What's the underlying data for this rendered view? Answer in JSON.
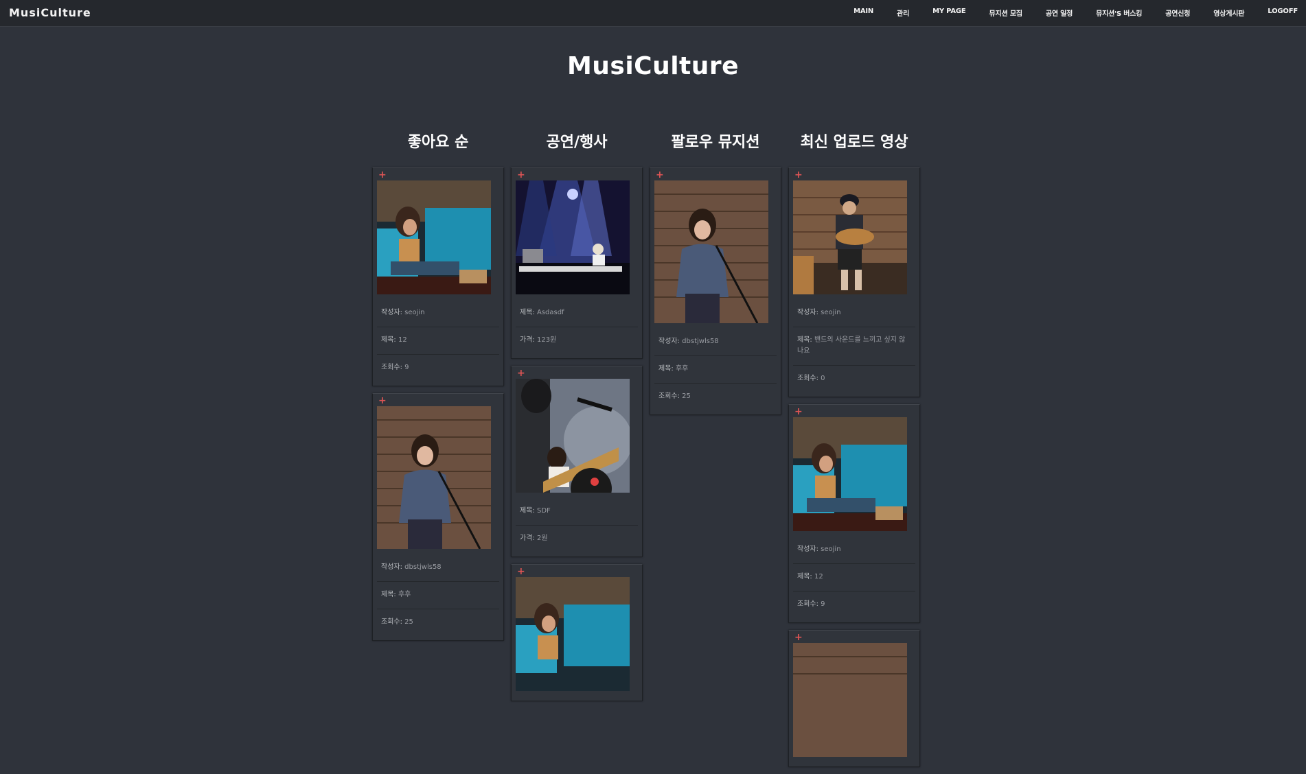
{
  "brand": "MusiCulture",
  "nav": [
    "MAIN",
    "관리",
    "MY PAGE",
    "뮤지션 모집",
    "공연 일정",
    "뮤지션'S 버스킹",
    "공연신청",
    "영상게시판",
    "LOGOFF"
  ],
  "hero_title": "MusiCulture",
  "columns": [
    {
      "heading": "좋아요 순",
      "cards": [
        {
          "image": "woman-singing-blue-stage",
          "rows": [
            {
              "key": "작성자:",
              "value": "seojin"
            },
            {
              "key": "제목:",
              "value": "12"
            },
            {
              "key": "조회수:",
              "value": "9"
            }
          ]
        },
        {
          "image": "woman-singing-wood-wall",
          "rows": [
            {
              "key": "작성자:",
              "value": "dbstjwls58"
            },
            {
              "key": "제목:",
              "value": "후후"
            },
            {
              "key": "조회수:",
              "value": "25"
            }
          ]
        }
      ]
    },
    {
      "heading": "공연/행사",
      "cards": [
        {
          "image": "concert-stage-lights",
          "rows": [
            {
              "key": "제목:",
              "value": "Asdasdf"
            },
            {
              "key": "가격:",
              "value": "123원"
            }
          ]
        },
        {
          "image": "guitarist-with-microphone",
          "rows": [
            {
              "key": "제목:",
              "value": "SDF"
            },
            {
              "key": "가격:",
              "value": "2원"
            }
          ]
        },
        {
          "image": "woman-singing-blue-stage",
          "rows": []
        }
      ]
    },
    {
      "heading": "팔로우 뮤지션",
      "cards": [
        {
          "image": "woman-singing-wood-wall",
          "rows": [
            {
              "key": "작성자:",
              "value": "dbstjwls58"
            },
            {
              "key": "제목:",
              "value": "후후"
            },
            {
              "key": "조회수:",
              "value": "25"
            }
          ]
        }
      ]
    },
    {
      "heading": "최신 업로드 영상",
      "cards": [
        {
          "image": "man-playing-guitar",
          "rows": [
            {
              "key": "작성자:",
              "value": "seojin"
            },
            {
              "key": "제목:",
              "value": "밴드의 사운드를 느끼고 싶지 않나요"
            },
            {
              "key": "조회수:",
              "value": "0"
            }
          ]
        },
        {
          "image": "woman-singing-blue-stage",
          "rows": [
            {
              "key": "작성자:",
              "value": "seojin"
            },
            {
              "key": "제목:",
              "value": "12"
            },
            {
              "key": "조회수:",
              "value": "9"
            }
          ]
        },
        {
          "image": "woman-singing-wood-wall",
          "rows": []
        }
      ]
    }
  ],
  "colors": {
    "background": "#2f333b",
    "nav_bg": "#25282d",
    "plus": "#e05555"
  }
}
